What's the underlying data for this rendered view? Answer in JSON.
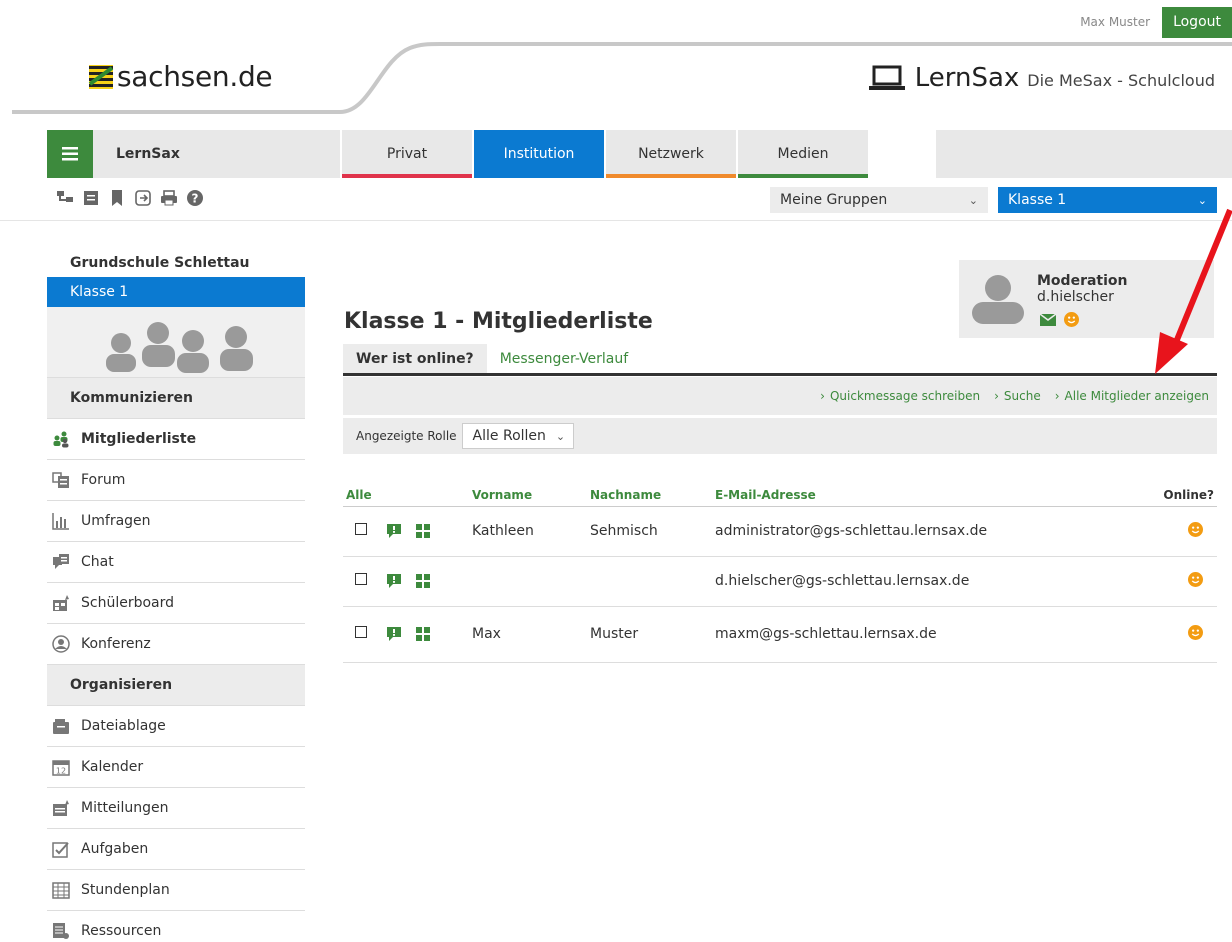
{
  "user_bar": {
    "username": "Max Muster",
    "logout_label": "Logout"
  },
  "header": {
    "sachsen_logo_text": "sachsen.de",
    "lernsax_brand": "LernSax",
    "lernsax_subtitle": "Die MeSax - Schulcloud"
  },
  "nav": {
    "brand": "LernSax",
    "tabs": [
      {
        "label": "Privat",
        "underline": "#e0334b"
      },
      {
        "label": "Institution",
        "underline": "#0b7ad1"
      },
      {
        "label": "Netzwerk",
        "underline": "#f08a2c"
      },
      {
        "label": "Medien",
        "underline": "#3d8a3d"
      }
    ],
    "active_tab": "Institution"
  },
  "toolbar": {
    "icons": [
      "sitemap-icon",
      "notes-icon",
      "bookmark-icon",
      "export-icon",
      "print-icon",
      "help-icon"
    ],
    "group_select": "Meine Gruppen",
    "class_select": "Klasse 1"
  },
  "sidebar": {
    "school": "Grundschule Schlettau",
    "active_group": "Klasse 1",
    "sections": [
      {
        "title": "Kommunizieren",
        "items": [
          {
            "label": "Mitgliederliste",
            "icon": "members-icon",
            "active": true
          },
          {
            "label": "Forum",
            "icon": "forum-icon"
          },
          {
            "label": "Umfragen",
            "icon": "poll-icon"
          },
          {
            "label": "Chat",
            "icon": "chat-icon"
          },
          {
            "label": "Schülerboard",
            "icon": "board-icon"
          },
          {
            "label": "Konferenz",
            "icon": "conference-icon"
          }
        ]
      },
      {
        "title": "Organisieren",
        "items": [
          {
            "label": "Dateiablage",
            "icon": "folder-icon"
          },
          {
            "label": "Kalender",
            "icon": "calendar-icon"
          },
          {
            "label": "Mitteilungen",
            "icon": "notice-icon"
          },
          {
            "label": "Aufgaben",
            "icon": "task-icon"
          },
          {
            "label": "Stundenplan",
            "icon": "timetable-icon"
          },
          {
            "label": "Ressourcen",
            "icon": "resources-icon"
          }
        ]
      }
    ]
  },
  "main": {
    "title": "Klasse 1 - Mitgliederliste",
    "moderation": {
      "role": "Moderation",
      "user": "d.hielscher"
    },
    "subtabs": [
      "Wer ist online?",
      "Messenger-Verlauf"
    ],
    "actions": [
      "Quickmessage schreiben",
      "Suche",
      "Alle Mitglieder anzeigen"
    ],
    "role_filter": {
      "label": "Angezeigte Rolle",
      "value": "Alle Rollen"
    },
    "table": {
      "headers": [
        "Alle",
        "",
        "Vorname",
        "Nachname",
        "E-Mail-Adresse",
        "Online?"
      ],
      "rows": [
        {
          "first": "Kathleen",
          "last": "Sehmisch",
          "email": "administrator@gs-schlettau.lernsax.de"
        },
        {
          "first": "",
          "last": "",
          "email": "d.hielscher@gs-schlettau.lernsax.de"
        },
        {
          "first": "Max",
          "last": "Muster",
          "email": "maxm@gs-schlettau.lernsax.de"
        }
      ]
    }
  },
  "colors": {
    "green": "#3d8a3d",
    "blue": "#0b7ad1",
    "orange": "#f39c12",
    "annotation_arrow": "#e8141c"
  }
}
